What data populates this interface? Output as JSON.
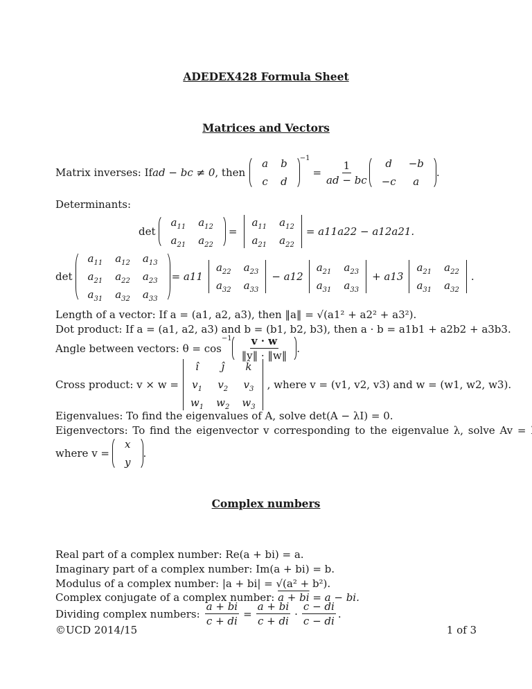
{
  "title": "ADEDEX428 Formula Sheet",
  "sections": {
    "matrices": {
      "heading": "Matrices and Vectors",
      "matrix_inverse_label": "Matrix inverses: If ",
      "matrix_inverse_condition": "ad − bc ≠ 0",
      "matrix_inverse_then": ", then",
      "inverse_matrix": [
        [
          "a",
          "b"
        ],
        [
          "c",
          "d"
        ]
      ],
      "inverse_exponent": "−1",
      "inverse_frac_num": "1",
      "inverse_frac_den": "ad − bc",
      "adjugate_matrix": [
        [
          "d",
          "−b"
        ],
        [
          "−c",
          "a"
        ]
      ],
      "determinants_label": "Determinants:",
      "det_op": "det",
      "det2_matrix": [
        [
          "a11",
          "a12"
        ],
        [
          "a21",
          "a22"
        ]
      ],
      "det2_result": "= a11a22 − a12a21.",
      "det3_matrix": [
        [
          "a11",
          "a12",
          "a13"
        ],
        [
          "a21",
          "a22",
          "a23"
        ],
        [
          "a31",
          "a32",
          "a33"
        ]
      ],
      "det3_terms": [
        {
          "sign": "= a11",
          "minor": [
            [
              "a22",
              "a23"
            ],
            [
              "a32",
              "a33"
            ]
          ]
        },
        {
          "sign": "− a12",
          "minor": [
            [
              "a21",
              "a23"
            ],
            [
              "a31",
              "a33"
            ]
          ]
        },
        {
          "sign": "+ a13",
          "minor": [
            [
              "a21",
              "a22"
            ],
            [
              "a31",
              "a32"
            ]
          ]
        }
      ],
      "length_text": "Length of a vector: If a = (a1, a2, a3), then ‖a‖ = √(a1² + a2² + a3²).",
      "dot_text": "Dot product: If a = (a1, a2, a3) and b = (b1, b2, b3), then a · b = a1b1 + a2b2 + a3b3.",
      "angle_label": "Angle between vectors: θ = cos",
      "angle_exponent": "−1",
      "angle_num": "v · w",
      "angle_den": "‖v‖ · ‖w‖",
      "cross_label": "Cross product: v × w =",
      "cross_matrix": [
        [
          "î",
          "ĵ",
          "k̂"
        ],
        [
          "v1",
          "v2",
          "v3"
        ],
        [
          "w1",
          "w2",
          "w3"
        ]
      ],
      "cross_where": ", where v = (v1, v2, v3) and w = (w1, w2, w3).",
      "eigenvalues_text": "Eigenvalues: To find the eigenvalues of A, solve det(A − λI) = 0.",
      "eigenvectors_text": "Eigenvectors: To find the eigenvector v corresponding to the eigenvalue λ, solve Av = λv,",
      "eigenvector_where": "where v =",
      "eigenvector_matrix": [
        "x",
        "y"
      ]
    },
    "complex": {
      "heading": "Complex numbers",
      "real_part": "Real part of a complex number: Re(a + bi) = a.",
      "imag_part": "Imaginary part of a complex number: Im(a + bi) = b.",
      "modulus": "Modulus of a complex number: |a + bi| = √(a² + b²).",
      "conjugate_label": "Complex conjugate of a complex number: ",
      "conjugate_over": "a + bi",
      "conjugate_result": " = a − bi.",
      "dividing_label": "Dividing complex numbers:",
      "dividing_fracs": [
        {
          "num": "a + bi",
          "den": "c + di"
        },
        {
          "num": "a + bi",
          "den": "c + di"
        },
        {
          "num": "c − di",
          "den": "c − di"
        }
      ]
    }
  },
  "footer": {
    "copyright": "©UCD 2014/15",
    "page": "1 of 3"
  }
}
